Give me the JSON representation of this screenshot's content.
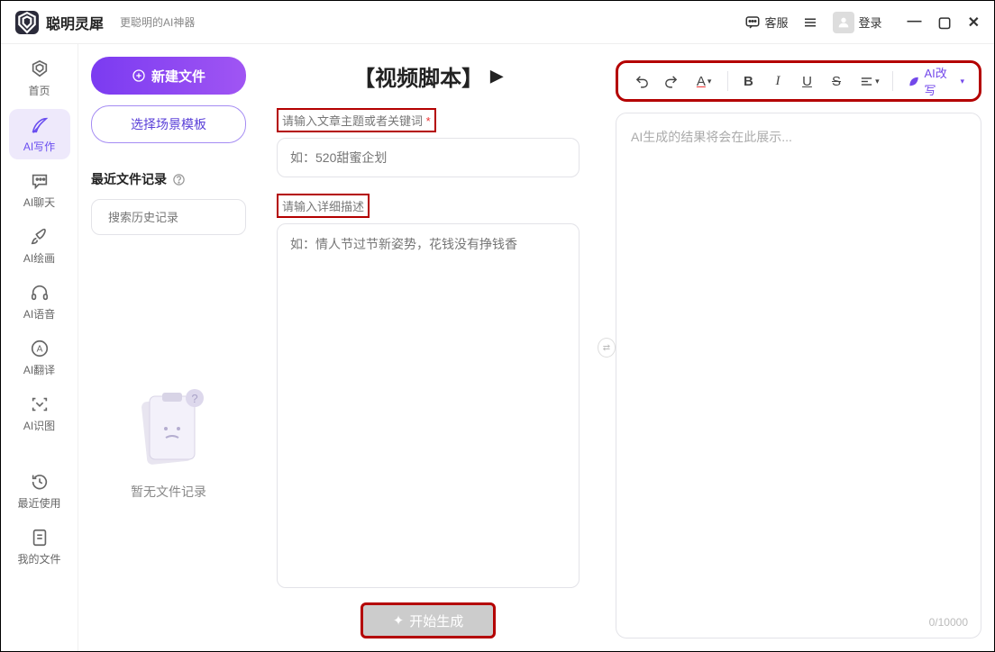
{
  "app": {
    "name": "聪明灵犀",
    "subtitle": "更聪明的AI神器"
  },
  "titlebar": {
    "service": "客服",
    "login": "登录"
  },
  "sidebar": {
    "items": [
      {
        "label": "首页"
      },
      {
        "label": "AI写作"
      },
      {
        "label": "AI聊天"
      },
      {
        "label": "AI绘画"
      },
      {
        "label": "AI语音"
      },
      {
        "label": "AI翻译"
      },
      {
        "label": "AI识图"
      },
      {
        "label": "最近使用"
      },
      {
        "label": "我的文件"
      }
    ]
  },
  "leftPanel": {
    "newFile": "新建文件",
    "templateBtn": "选择场景模板",
    "recentTitle": "最近文件记录",
    "searchPlaceholder": "搜索历史记录",
    "emptyText": "暂无文件记录"
  },
  "center": {
    "title": "【视频脚本】",
    "label1": "请输入文章主题或者关键词",
    "placeholder1": "如：520甜蜜企划",
    "label2": "请输入详细描述",
    "placeholder2": "如：情人节过节新姿势，花钱没有挣钱香",
    "generateBtn": "开始生成"
  },
  "right": {
    "aiRewrite": "AI改写",
    "outputPlaceholder": "AI生成的结果将会在此展示...",
    "counter": "0/10000"
  }
}
